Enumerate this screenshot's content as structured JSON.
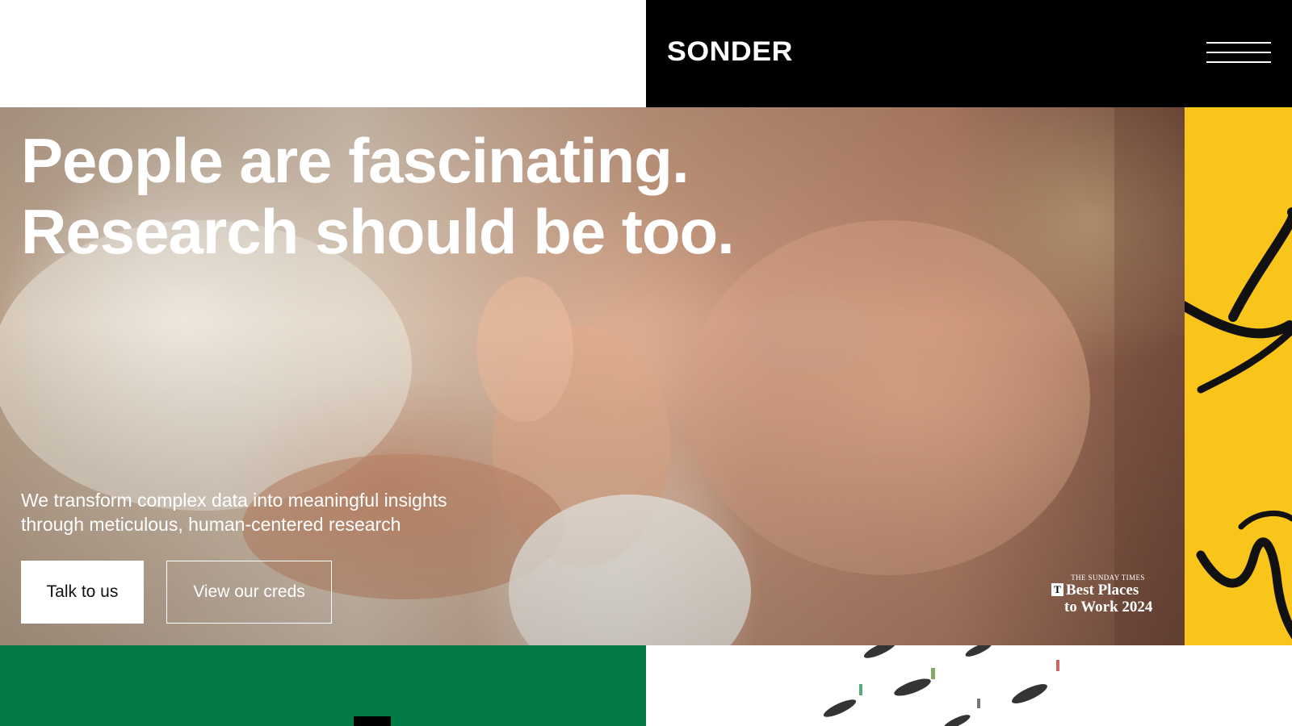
{
  "header": {
    "logo": "SONDER",
    "menu_icon": "hamburger-menu-icon"
  },
  "hero": {
    "title_lines": [
      "People are fascinating.",
      "Research should be too."
    ],
    "subtitle_lines": [
      "We transform complex data into meaningful insights",
      "through meticulous, human-centered research"
    ],
    "primary_button": "Talk to us",
    "secondary_button": "View our creds",
    "award": {
      "masthead": "THE SUNDAY TIMES",
      "line1": "Best Places",
      "line2": "to Work 2024",
      "logo_letter": "T"
    }
  },
  "colors": {
    "header_bg": "#000000",
    "accent_yellow": "#f9c51a",
    "accent_green": "#037b45",
    "text_light": "#ffffff"
  }
}
